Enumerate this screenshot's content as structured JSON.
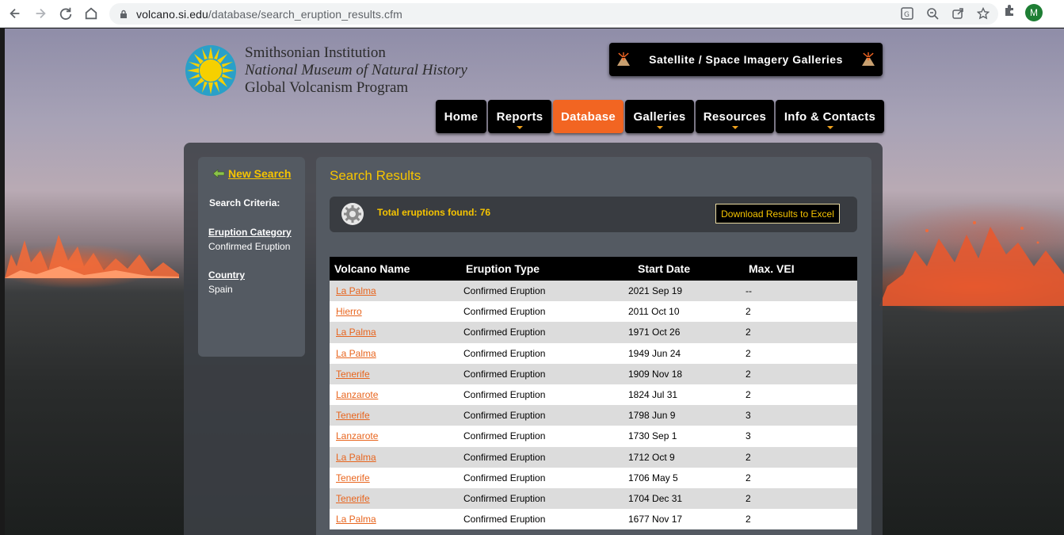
{
  "browser": {
    "url_host": "volcano.si.edu",
    "url_path": "/database/search_eruption_results.cfm",
    "profile_initial": "M"
  },
  "header": {
    "logo_line1": "Smithsonian Institution",
    "logo_line2": "National Museum of Natural History",
    "logo_line3": "Global Volcanism Program",
    "satellite_label": "Satellite / Space Imagery Galleries"
  },
  "menu": [
    {
      "label": "Home",
      "dropdown": false,
      "active": false
    },
    {
      "label": "Reports",
      "dropdown": true,
      "active": false
    },
    {
      "label": "Database",
      "dropdown": false,
      "active": true
    },
    {
      "label": "Galleries",
      "dropdown": true,
      "active": false
    },
    {
      "label": "Resources",
      "dropdown": true,
      "active": false
    },
    {
      "label": "Info & Contacts",
      "dropdown": true,
      "active": false
    }
  ],
  "sidebar": {
    "new_search": "New Search",
    "criteria_title": "Search Criteria:",
    "criteria": [
      {
        "label": "Eruption Category",
        "value": "Confirmed Eruption"
      },
      {
        "label": "Country",
        "value": "Spain"
      }
    ]
  },
  "results": {
    "title": "Search Results",
    "count_text": "Total eruptions found: 76",
    "download_label": "Download Results to Excel",
    "columns": [
      "Volcano Name",
      "Eruption Type",
      "Start Date",
      "Max. VEI"
    ],
    "rows": [
      [
        "La Palma",
        "Confirmed Eruption",
        "2021 Sep 19",
        "--"
      ],
      [
        "Hierro",
        "Confirmed Eruption",
        "2011 Oct 10",
        "2"
      ],
      [
        "La Palma",
        "Confirmed Eruption",
        "1971 Oct 26",
        "2"
      ],
      [
        "La Palma",
        "Confirmed Eruption",
        "1949 Jun 24",
        "2"
      ],
      [
        "Tenerife",
        "Confirmed Eruption",
        "1909 Nov 18",
        "2"
      ],
      [
        "Lanzarote",
        "Confirmed Eruption",
        "1824 Jul 31",
        "2"
      ],
      [
        "Tenerife",
        "Confirmed Eruption",
        "1798 Jun 9",
        "3"
      ],
      [
        "Lanzarote",
        "Confirmed Eruption",
        "1730 Sep 1",
        "3"
      ],
      [
        "La Palma",
        "Confirmed Eruption",
        "1712 Oct 9",
        "2"
      ],
      [
        "Tenerife",
        "Confirmed Eruption",
        "1706 May 5",
        "2"
      ],
      [
        "Tenerife",
        "Confirmed Eruption",
        "1704 Dec 31",
        "2"
      ],
      [
        "La Palma",
        "Confirmed Eruption",
        "1677 Nov 17",
        "2"
      ]
    ]
  },
  "colors": {
    "accent_orange": "#f26522",
    "link_orange": "#e8651e",
    "gold": "#f6c400"
  }
}
